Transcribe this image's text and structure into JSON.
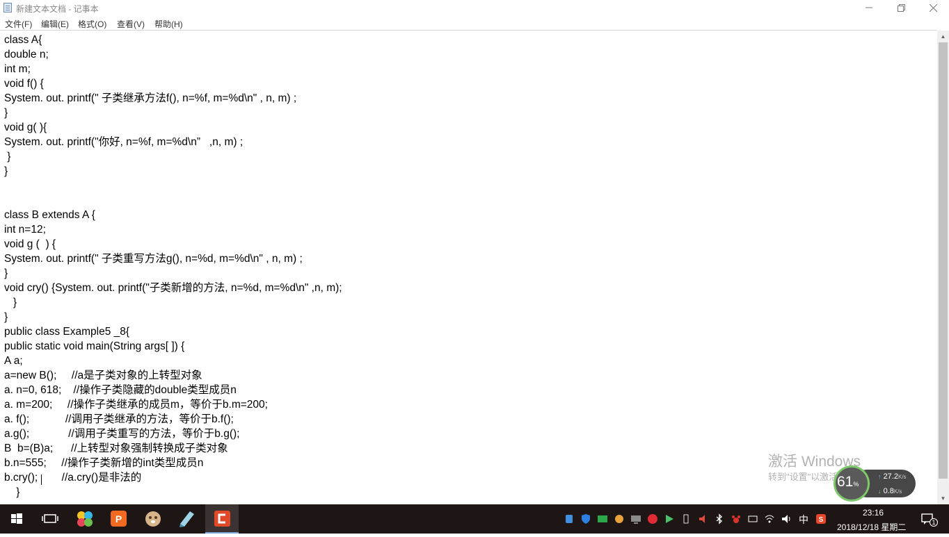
{
  "window": {
    "title": "新建文本文档 - 记事本",
    "minimize": "—",
    "restore": "❐",
    "close": "✕"
  },
  "menu": {
    "items": [
      "文件(F)",
      "编辑(E)",
      "格式(O)",
      "查看(V)",
      "帮助(H)"
    ]
  },
  "editor": {
    "lines": [
      "class A{",
      "double n;",
      "int m;",
      "void f() {",
      "System. out. printf(\" 子类继承方法f(), n=%f, m=%d\\n\" , n, m) ;",
      "}",
      "void g( ){",
      "System. out. printf(\"你好, n=%f, m=%d\\n”   ,n, m) ;",
      " }",
      "}",
      "",
      "",
      "class B extends A {",
      "int n=12;",
      "void g (  ) {",
      "System. out. printf(\" 子类重写方法g(), n=%d, m=%d\\n\" , n, m) ;",
      "}",
      "void cry() {System. out. printf(\"子类新增的方法, n=%d, m=%d\\n\" ,n, m);",
      "   }",
      "}",
      "public class Example5 _8{",
      "public static void main(String args[ ]) {",
      "A a;",
      "a=new B();     //a是子类对象的上转型对象",
      "a. n=0, 618;    //操作子类隐藏的double类型成员n",
      "a. m=200;     //操作子类继承的成员m，等价于b.m=200;",
      "a. f();            //调用子类继承的方法，等价于b.f();",
      "a.g();             //调用子类重写的方法，等价于b.g();",
      "B  b=(B)a;      //上转型对象强制转换成子类对象",
      "b.n=555;     //操作子类新增的int类型成员n",
      "b.cry();        //a.cry()是非法的",
      "    }"
    ]
  },
  "watermark": {
    "line1": "激活 Windows",
    "line2": "转到\"设置\"以激活 Windows。"
  },
  "net_widget": {
    "percent": "61",
    "percent_sign": "%",
    "upload": "27.2",
    "download": "0.8",
    "unit": "K/s"
  },
  "taskbar": {
    "apps": [
      "windows-start-icon",
      "task-view-icon",
      "pinwheel-app-icon",
      "wps-presentation-icon",
      "cat-app-icon",
      "pen-app-icon",
      "camtasia-icon"
    ],
    "ime": "中",
    "time": "23:16",
    "date": "2018/12/18 星期二",
    "notification_count": "1"
  },
  "colors": {
    "taskbar_bg": "#1d1614",
    "accent": "#7aa7d8",
    "wps_orange": "#f26a21",
    "camtasia_red": "#e04a2a",
    "speed_ring": "#7cc86a"
  }
}
